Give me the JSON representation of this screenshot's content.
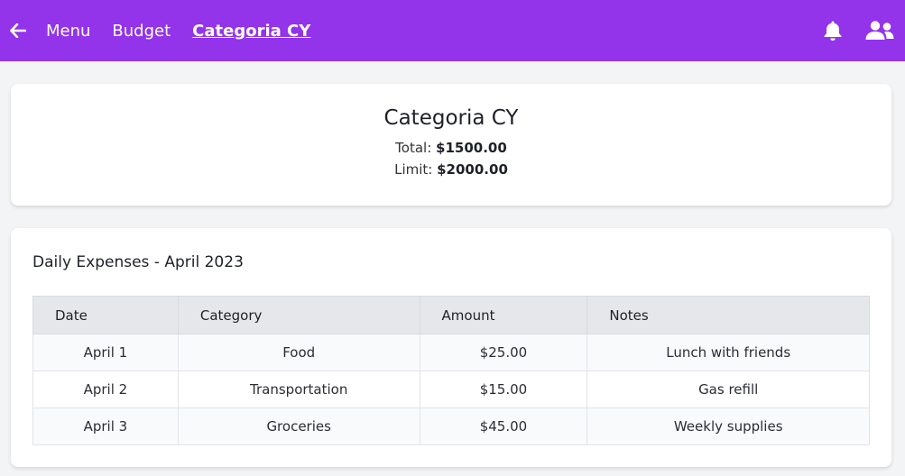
{
  "topbar": {
    "back_icon": "arrow-left-icon",
    "nav": [
      {
        "label": "Menu"
      },
      {
        "label": "Budget"
      },
      {
        "label": "Categoria CY",
        "active": true
      }
    ],
    "bell_icon": "bell-icon",
    "users_icon": "users-icon",
    "accent_color": "#9333ea"
  },
  "summary": {
    "title": "Categoria CY",
    "total_label": "Total:",
    "total_value": "$1500.00",
    "limit_label": "Limit:",
    "limit_value": "$2000.00"
  },
  "expenses": {
    "title": "Daily Expenses - April 2023",
    "columns": [
      "Date",
      "Category",
      "Amount",
      "Notes"
    ],
    "rows": [
      {
        "date": "April 1",
        "category": "Food",
        "amount": "$25.00",
        "notes": "Lunch with friends"
      },
      {
        "date": "April 2",
        "category": "Transportation",
        "amount": "$15.00",
        "notes": "Gas refill"
      },
      {
        "date": "April 3",
        "category": "Groceries",
        "amount": "$45.00",
        "notes": "Weekly supplies"
      }
    ]
  }
}
